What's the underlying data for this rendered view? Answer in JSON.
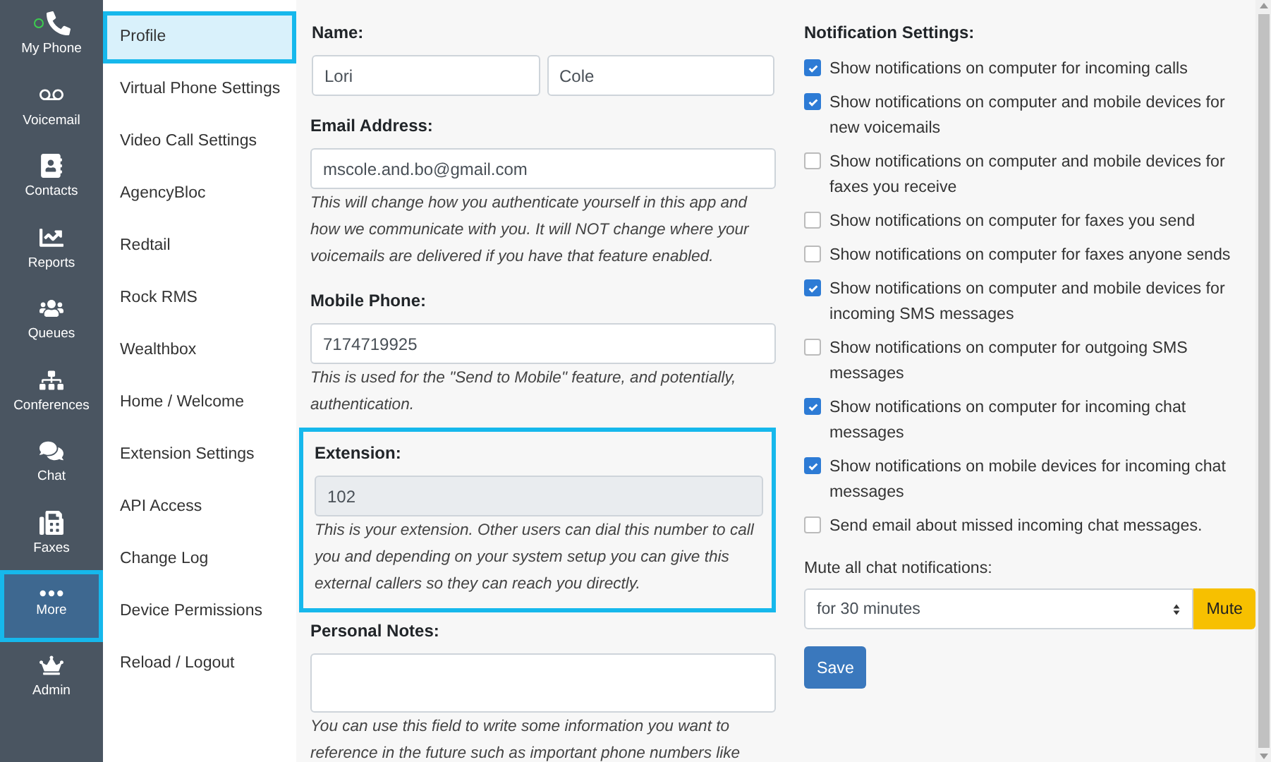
{
  "rail": [
    {
      "label": "My Phone",
      "selected": false
    },
    {
      "label": "Voicemail",
      "selected": false
    },
    {
      "label": "Contacts",
      "selected": false
    },
    {
      "label": "Reports",
      "selected": false
    },
    {
      "label": "Queues",
      "selected": false
    },
    {
      "label": "Conferences",
      "selected": false
    },
    {
      "label": "Chat",
      "selected": false
    },
    {
      "label": "Faxes",
      "selected": false
    },
    {
      "label": "More",
      "selected": true
    },
    {
      "label": "Admin",
      "selected": false
    }
  ],
  "menu": [
    {
      "label": "Profile",
      "selected": true
    },
    {
      "label": "Virtual Phone Settings",
      "selected": false
    },
    {
      "label": "Video Call Settings",
      "selected": false
    },
    {
      "label": "AgencyBloc",
      "selected": false
    },
    {
      "label": "Redtail",
      "selected": false
    },
    {
      "label": "Rock RMS",
      "selected": false
    },
    {
      "label": "Wealthbox",
      "selected": false
    },
    {
      "label": "Home / Welcome",
      "selected": false
    },
    {
      "label": "Extension Settings",
      "selected": false
    },
    {
      "label": "API Access",
      "selected": false
    },
    {
      "label": "Change Log",
      "selected": false
    },
    {
      "label": "Device Permissions",
      "selected": false
    },
    {
      "label": "Reload / Logout",
      "selected": false
    }
  ],
  "profile": {
    "name": {
      "label": "Name:",
      "first": "Lori",
      "last": "Cole"
    },
    "email": {
      "label": "Email Address:",
      "value": "mscole.and.bo@gmail.com",
      "help": "This will change how you authenticate yourself in this app and how we communicate with you. It will NOT change where your voicemails are delivered if you have that feature enabled."
    },
    "mobile": {
      "label": "Mobile Phone:",
      "value": "7174719925",
      "help": "This is used for the \"Send to Mobile\" feature, and potentially, authentication."
    },
    "extension": {
      "label": "Extension:",
      "value": "102",
      "disabled": true,
      "highlighted": true,
      "help": "This is your extension. Other users can dial this number to call you and depending on your system setup you can give this external callers so they can reach you directly."
    },
    "notes": {
      "label": "Personal Notes:",
      "help": "You can use this field to write some information you want to reference in the future such as important phone numbers like"
    }
  },
  "notifications": {
    "title": "Notification Settings:",
    "options": [
      {
        "label": "Show notifications on computer for incoming calls",
        "checked": true
      },
      {
        "label": "Show notifications on computer and mobile devices for new voicemails",
        "checked": true
      },
      {
        "label": "Show notifications on computer and mobile devices for faxes you receive",
        "checked": false
      },
      {
        "label": "Show notifications on computer for faxes you send",
        "checked": false
      },
      {
        "label": "Show notifications on computer for faxes anyone sends",
        "checked": false
      },
      {
        "label": "Show notifications on computer and mobile devices for incoming SMS messages",
        "checked": true
      },
      {
        "label": "Show notifications on computer for outgoing SMS messages",
        "checked": false
      },
      {
        "label": "Show notifications on computer for incoming chat messages",
        "checked": true
      },
      {
        "label": "Show notifications on mobile devices for incoming chat messages",
        "checked": true
      },
      {
        "label": "Send email about missed incoming chat messages.",
        "checked": false
      }
    ],
    "mute_label": "Mute all chat notifications:",
    "mute_value": "for 30 minutes",
    "mute_button": "Mute",
    "save_button": "Save"
  }
}
